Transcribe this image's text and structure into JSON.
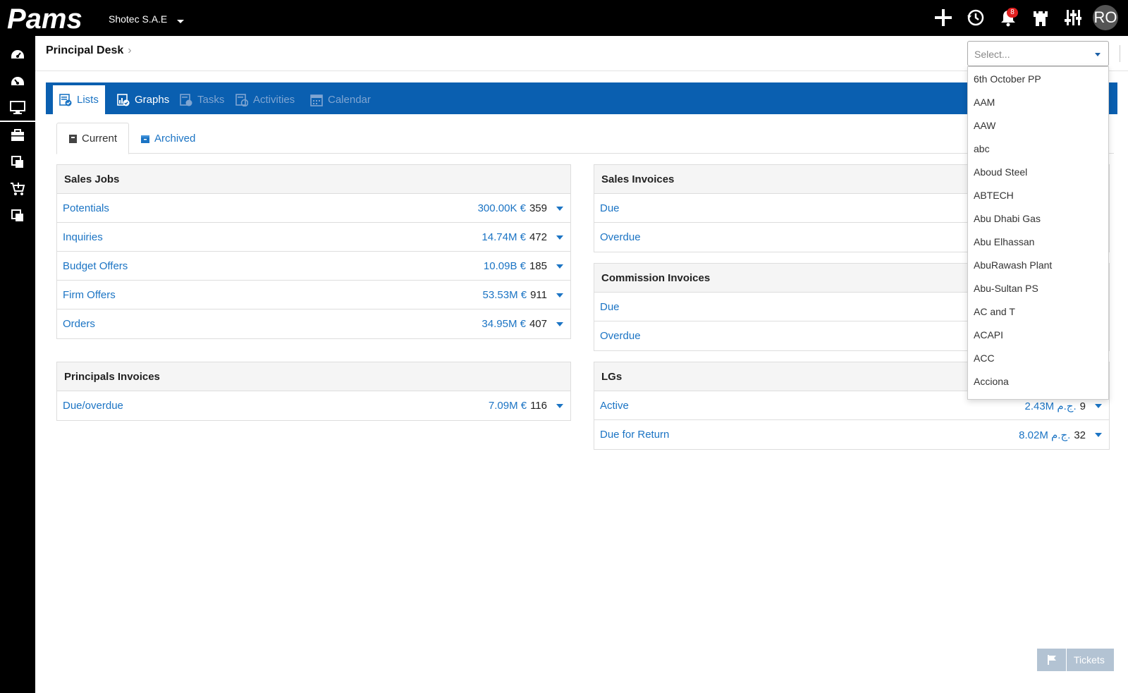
{
  "topbar": {
    "logo_text": "Pams",
    "company": "Shotec S.A.E",
    "notifications_count": "8",
    "avatar_initials": "RO",
    "icons": [
      "plus-icon",
      "history-icon",
      "bell-icon",
      "castle-icon",
      "sliders-icon"
    ]
  },
  "sidebar": {
    "icons": [
      "dashboard-icon",
      "dashboard-alt-icon",
      "monitor-icon",
      "briefcase-icon",
      "documents-icon",
      "cart-icon",
      "documents-alt-icon"
    ]
  },
  "page": {
    "title": "Principal Desk",
    "chevron": "›"
  },
  "select": {
    "placeholder": "Select...",
    "options": [
      "6th October PP",
      "AAM",
      "AAW",
      "abc",
      "Aboud Steel",
      "ABTECH",
      "Abu Dhabi Gas",
      "Abu Elhassan",
      "AbuRawash Plant",
      "Abu-Sultan PS",
      "AC and T",
      "ACAPI",
      "ACC",
      "Acciona"
    ]
  },
  "tabs": [
    {
      "label": "Lists"
    },
    {
      "label": "Graphs"
    },
    {
      "label": "Tasks"
    },
    {
      "label": "Activities"
    },
    {
      "label": "Calendar"
    }
  ],
  "subtabs": [
    {
      "label": "Current"
    },
    {
      "label": "Archived"
    }
  ],
  "panels": {
    "sales_jobs": {
      "title": "Sales Jobs",
      "rows": [
        {
          "label": "Potentials",
          "amount": "300.00K €",
          "count": "359"
        },
        {
          "label": "Inquiries",
          "amount": "14.74M €",
          "count": "472"
        },
        {
          "label": "Budget Offers",
          "amount": "10.09B €",
          "count": "185"
        },
        {
          "label": "Firm Offers",
          "amount": "53.53M €",
          "count": "911"
        },
        {
          "label": "Orders",
          "amount": "34.95M €",
          "count": "407"
        }
      ]
    },
    "principals_invoices": {
      "title": "Principals Invoices",
      "rows": [
        {
          "label": "Due/overdue",
          "amount": "7.09M €",
          "count": "116"
        }
      ]
    },
    "sales_invoices": {
      "title": "Sales Invoices",
      "rows": [
        {
          "label": "Due"
        },
        {
          "label": "Overdue"
        }
      ]
    },
    "commission_invoices": {
      "title": "Commission Invoices",
      "rows": [
        {
          "label": "Due"
        },
        {
          "label": "Overdue"
        }
      ]
    },
    "lgs": {
      "title": "LGs",
      "rows": [
        {
          "label": "Active",
          "amount": "2.43M ج.م.",
          "count": "9"
        },
        {
          "label": "Due for Return",
          "amount": "8.02M ج.م.",
          "count": "32"
        }
      ]
    }
  },
  "tickets": {
    "label": "Tickets"
  }
}
